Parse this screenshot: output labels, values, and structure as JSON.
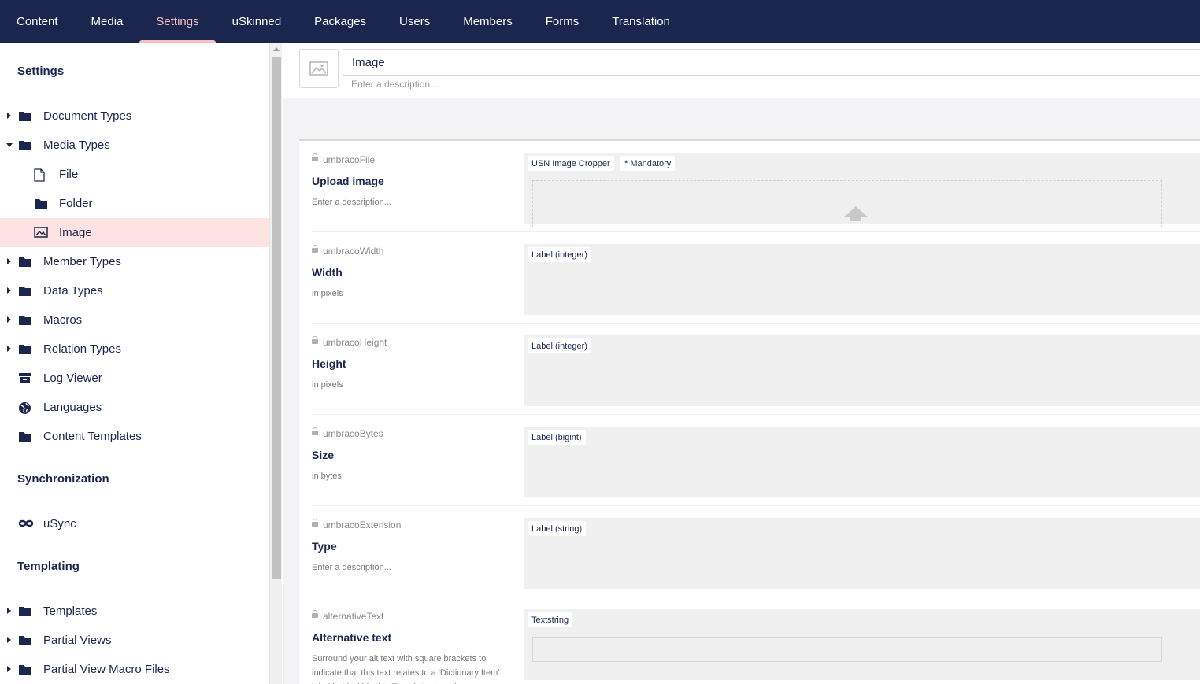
{
  "topnav": {
    "items": [
      {
        "label": "Content",
        "active": false
      },
      {
        "label": "Media",
        "active": false
      },
      {
        "label": "Settings",
        "active": true
      },
      {
        "label": "uSkinned",
        "active": false
      },
      {
        "label": "Packages",
        "active": false
      },
      {
        "label": "Users",
        "active": false
      },
      {
        "label": "Members",
        "active": false
      },
      {
        "label": "Forms",
        "active": false
      },
      {
        "label": "Translation",
        "active": false
      }
    ]
  },
  "sidebar": {
    "settings_title": "Settings",
    "tree": [
      {
        "label": "Document Types",
        "icon": "folder-icon",
        "caret": "right"
      },
      {
        "label": "Media Types",
        "icon": "folder-icon",
        "caret": "down"
      },
      {
        "label": "File",
        "icon": "file-icon"
      },
      {
        "label": "Folder",
        "icon": "folder-icon"
      },
      {
        "label": "Image",
        "icon": "image-icon",
        "selected": true
      },
      {
        "label": "Member Types",
        "icon": "folder-icon",
        "caret": "right"
      },
      {
        "label": "Data Types",
        "icon": "folder-icon",
        "caret": "right"
      },
      {
        "label": "Macros",
        "icon": "folder-icon",
        "caret": "right"
      },
      {
        "label": "Relation Types",
        "icon": "folder-icon",
        "caret": "right"
      },
      {
        "label": "Log Viewer",
        "icon": "archive-icon"
      },
      {
        "label": "Languages",
        "icon": "globe-icon"
      },
      {
        "label": "Content Templates",
        "icon": "folder-icon"
      }
    ],
    "sync_title": "Synchronization",
    "sync_items": [
      {
        "label": "uSync",
        "icon": "infinity-icon"
      }
    ],
    "templating_title": "Templating",
    "templating_items": [
      {
        "label": "Templates",
        "icon": "folder-icon",
        "caret": "right"
      },
      {
        "label": "Partial Views",
        "icon": "folder-icon",
        "caret": "right"
      },
      {
        "label": "Partial View Macro Files",
        "icon": "folder-icon",
        "caret": "right"
      }
    ]
  },
  "header": {
    "name_value": "Image",
    "description_placeholder": "Enter a description..."
  },
  "properties": [
    {
      "alias": "umbracoFile",
      "label": "Upload image",
      "description": "Enter a description...",
      "editor": "USN Image Cropper",
      "mandatory": "* Mandatory",
      "kind": "upload"
    },
    {
      "alias": "umbracoWidth",
      "label": "Width",
      "description": "in pixels",
      "editor": "Label (integer)"
    },
    {
      "alias": "umbracoHeight",
      "label": "Height",
      "description": "in pixels",
      "editor": "Label (integer)"
    },
    {
      "alias": "umbracoBytes",
      "label": "Size",
      "description": "in bytes",
      "editor": "Label (bigint)"
    },
    {
      "alias": "umbracoExtension",
      "label": "Type",
      "description": "Enter a description...",
      "editor": "Label (string)"
    },
    {
      "alias": "alternativeText",
      "label": "Alternative text",
      "description": "Surround your alt text with square brackets to indicate that this text relates to a 'Dictionary Item' label held within the 'Translation' section.",
      "editor": "Textstring",
      "kind": "textstring"
    }
  ],
  "colors": {
    "nav_bg": "#1b264f",
    "accent": "#f5c1bc",
    "selected_bg": "#fde4e3"
  }
}
